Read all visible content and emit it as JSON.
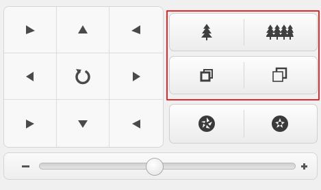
{
  "ptz": {
    "directions": [
      "up-left",
      "up",
      "up-right",
      "left",
      "reset",
      "right",
      "down-left",
      "down",
      "down-right"
    ],
    "icons": {
      "arrow": "triangle-arrow-icon",
      "reset": "rotate-reset-icon"
    }
  },
  "lens_controls": [
    {
      "name": "zoom",
      "icons": [
        "single-tree-icon",
        "forest-icon"
      ]
    },
    {
      "name": "focus",
      "icons": [
        "small-squares-icon",
        "large-squares-icon"
      ]
    },
    {
      "name": "iris",
      "icons": [
        "iris-close-icon",
        "iris-open-icon"
      ]
    }
  ],
  "speed": {
    "level": 0.45,
    "icons": {
      "decrease": "minus-icon",
      "increase": "plus-icon"
    }
  },
  "colors": {
    "highlight": "#e12a2a",
    "icon": "#4a4a4a",
    "panel_bg": "#f6f6f6"
  }
}
